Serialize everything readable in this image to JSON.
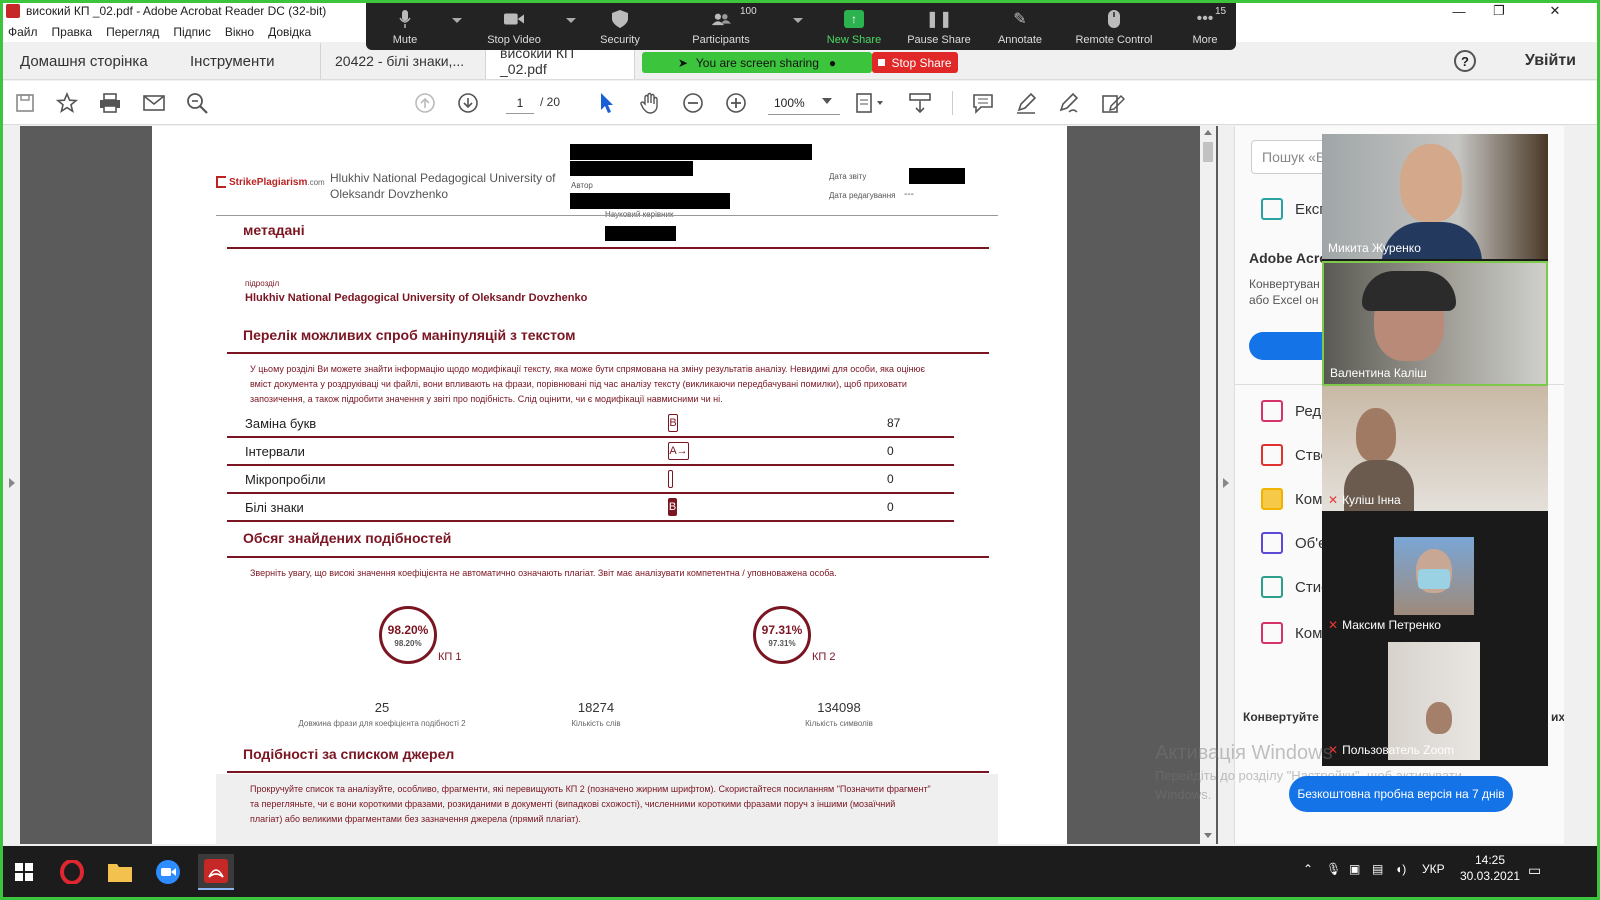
{
  "titlebar": {
    "title": "високий КП _02.pdf - Adobe Acrobat Reader DC (32-bit)",
    "minimize": "—",
    "restore": "❐",
    "close": "✕"
  },
  "menubar": {
    "items": [
      "Файл",
      "Правка",
      "Перегляд",
      "Підпис",
      "Вікно",
      "Довідка"
    ]
  },
  "tabs": {
    "home": "Домашня сторінка",
    "tools": "Інструменти",
    "doc1": "20422 - білі знаки,...",
    "doc2": "високий КП _02.pdf",
    "help": "?",
    "signin": "Увійти"
  },
  "toolbar": {
    "page_current": "1",
    "page_total": "/   20",
    "zoom": "100%"
  },
  "zoom_meeting": {
    "mute": "Mute",
    "stop_video": "Stop Video",
    "security": "Security",
    "participants": "Participants",
    "participants_count": "100",
    "new_share": "New Share",
    "pause_share": "Pause Share",
    "annotate": "Annotate",
    "remote_control": "Remote Control",
    "more": "More",
    "more_count": "15",
    "sharing_status": "You are screen sharing",
    "stop_share": "Stop Share"
  },
  "report": {
    "logo": "StrikePlagiarism",
    "logo_suffix": ".com",
    "university_header": "Hlukhiv National Pedagogical University of Oleksandr Dovzhenko",
    "author_label": "Автор",
    "supervisor_label": "Науковий керівник",
    "report_date_label": "Дата звіту",
    "edit_date_label": "Дата редагування",
    "edit_date_value": "---",
    "metadata_title": "метадані",
    "subdivision_label": "підрозділ",
    "subdivision_value": "Hlukhiv National Pedagogical University of Oleksandr Dovzhenko",
    "manipulations_title": "Перелік можливих спроб маніпуляцій з текстом",
    "manipulations_desc_1": "У цьому розділі Ви можете знайти інформацію щодо модифікації тексту, яка може бути спрямована на зміну результатів аналізу. Невидимі для особи, яка оцінює",
    "manipulations_desc_2": "вміст документа у роздруківаці чи файлі, вони впливають на фрази, порівнювані під час аналізу тексту (викликаючи передбачувані помилки), щоб приховати",
    "manipulations_desc_3": "запозичення, а також підробити значення у звіті про подібність. Слід оцінити, чи є модифікації навмисними чи ні.",
    "manipulations": [
      {
        "label": "Заміна букв",
        "icon": "B",
        "value": "87"
      },
      {
        "label": "Інтервали",
        "icon": "A→",
        "value": "0"
      },
      {
        "label": "Мікропробіли",
        "icon": "",
        "value": "0"
      },
      {
        "label": "Білі знаки",
        "icon": "B",
        "value": "0"
      }
    ],
    "similarity_title": "Обсяг знайдених подібностей",
    "similarity_note": "Зверніть увагу, що високі значення коефіцієнта не автоматично означають плагіат. Звіт має аналізувати компетентна / уповноважена особа.",
    "kp1": {
      "value": "98.20%",
      "sub": "98.20%",
      "label": "КП 1",
      "fraction": 0.982
    },
    "kp2": {
      "value": "97.31%",
      "sub": "97.31%",
      "label": "КП 2",
      "fraction": 0.9731
    },
    "stats": [
      {
        "num": "25",
        "cap": "Довжина фрази для коефіцієнта подібності 2"
      },
      {
        "num": "18274",
        "cap": "Кількість слів"
      },
      {
        "num": "134098",
        "cap": "Кількість символів"
      }
    ],
    "sources_title": "Подібності за списком джерел",
    "sources_desc_1": "Прокручуйте список та аналізуйте, особливо, фрагменти, які перевищують КП 2 (позначено жирним шрифтом). Скористайтеся посиланням \"Позначити фрагмент\"",
    "sources_desc_2": "та перегляньте, чи є вони короткими фразами, розкиданими в документі (випадкові схожості), численними короткими фразами поруч  з іншими (мозаїчний",
    "sources_desc_3": "плагіат) або великими фрагментами без зазначення джерела (прямий плагіат)."
  },
  "right_panel": {
    "search_placeholder": "Пошук «Е",
    "export": "Експ",
    "adobe_title": "Adobe Acro",
    "adobe_sub_1": "Конвертуван",
    "adobe_sub_2": "або Excel он",
    "edit": "Реда",
    "create": "Ство",
    "comment": "Ком",
    "combine": "Об'є",
    "compress": "Стис",
    "compare": "Ком",
    "convert": "Конвертуйте",
    "convert_tail": "их",
    "trial_button": "Безкоштовна пробна версія на 7 днів"
  },
  "activation": {
    "title": "Активація Windows",
    "sub_1": "Перейдіть до розділу \"Настройки\", щоб активувати",
    "sub_2": "Windows."
  },
  "participants": [
    {
      "name": "Микита Журенко",
      "muted": false
    },
    {
      "name": "Валентина Каліш",
      "muted": false
    },
    {
      "name": "Куліш Інна",
      "muted": true
    },
    {
      "name": "Максим Петренко",
      "muted": true
    },
    {
      "name": "Пользователь Zoom",
      "muted": true
    }
  ],
  "taskbar": {
    "lang": "УКР",
    "time": "14:25",
    "date": "30.03.2021"
  },
  "colors": {
    "accent": "#7a1522",
    "zoom_green": "#3cc43c",
    "stop_red": "#e02828",
    "adobe_blue": "#1473e6"
  }
}
